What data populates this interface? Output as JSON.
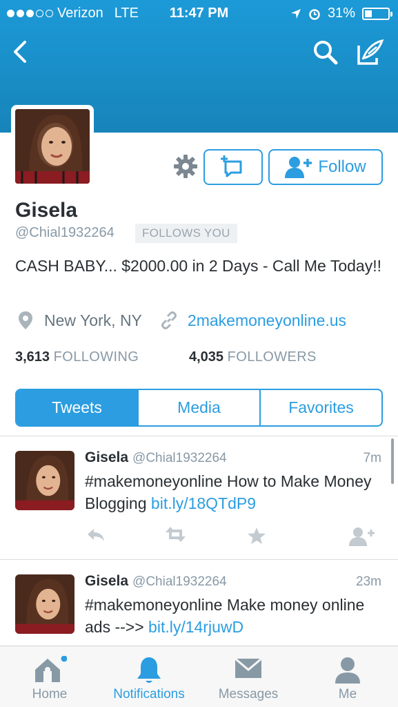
{
  "status_bar": {
    "carrier": "Verizon",
    "network": "LTE",
    "time": "11:47 PM",
    "battery": "31%",
    "battery_level": 0.31
  },
  "profile": {
    "name": "Gisela",
    "handle": "@Chial1932264",
    "follows_you": "FOLLOWS YOU",
    "follow_label": "Follow",
    "bio": "CASH BABY... $2000.00 in 2 Days - Call Me Today!!",
    "location": "New York, NY",
    "url": "2makemoneyonline.us",
    "following_count": "3,613",
    "following_label": "FOLLOWING",
    "followers_count": "4,035",
    "followers_label": "FOLLOWERS"
  },
  "tabs": [
    {
      "label": "Tweets",
      "active": true
    },
    {
      "label": "Media",
      "active": false
    },
    {
      "label": "Favorites",
      "active": false
    }
  ],
  "tweets": [
    {
      "name": "Gisela",
      "handle": "@Chial1932264",
      "time": "7m",
      "text": "#makemoneyonline How to Make Money Blogging ",
      "link": "bit.ly/18QTdP9"
    },
    {
      "name": "Gisela",
      "handle": "@Chial1932264",
      "time": "23m",
      "text": "#makemoneyonline Make money online ads -->> ",
      "link": "bit.ly/14rjuwD"
    }
  ],
  "tabbar": [
    {
      "label": "Home",
      "icon": "home-icon",
      "active": false
    },
    {
      "label": "Notifications",
      "icon": "bell-icon",
      "active": true
    },
    {
      "label": "Messages",
      "icon": "envelope-icon",
      "active": false
    },
    {
      "label": "Me",
      "icon": "person-icon",
      "active": false
    }
  ],
  "colors": {
    "accent": "#2b9de0",
    "header": "#1c9ad8",
    "muted": "#8899a6"
  }
}
